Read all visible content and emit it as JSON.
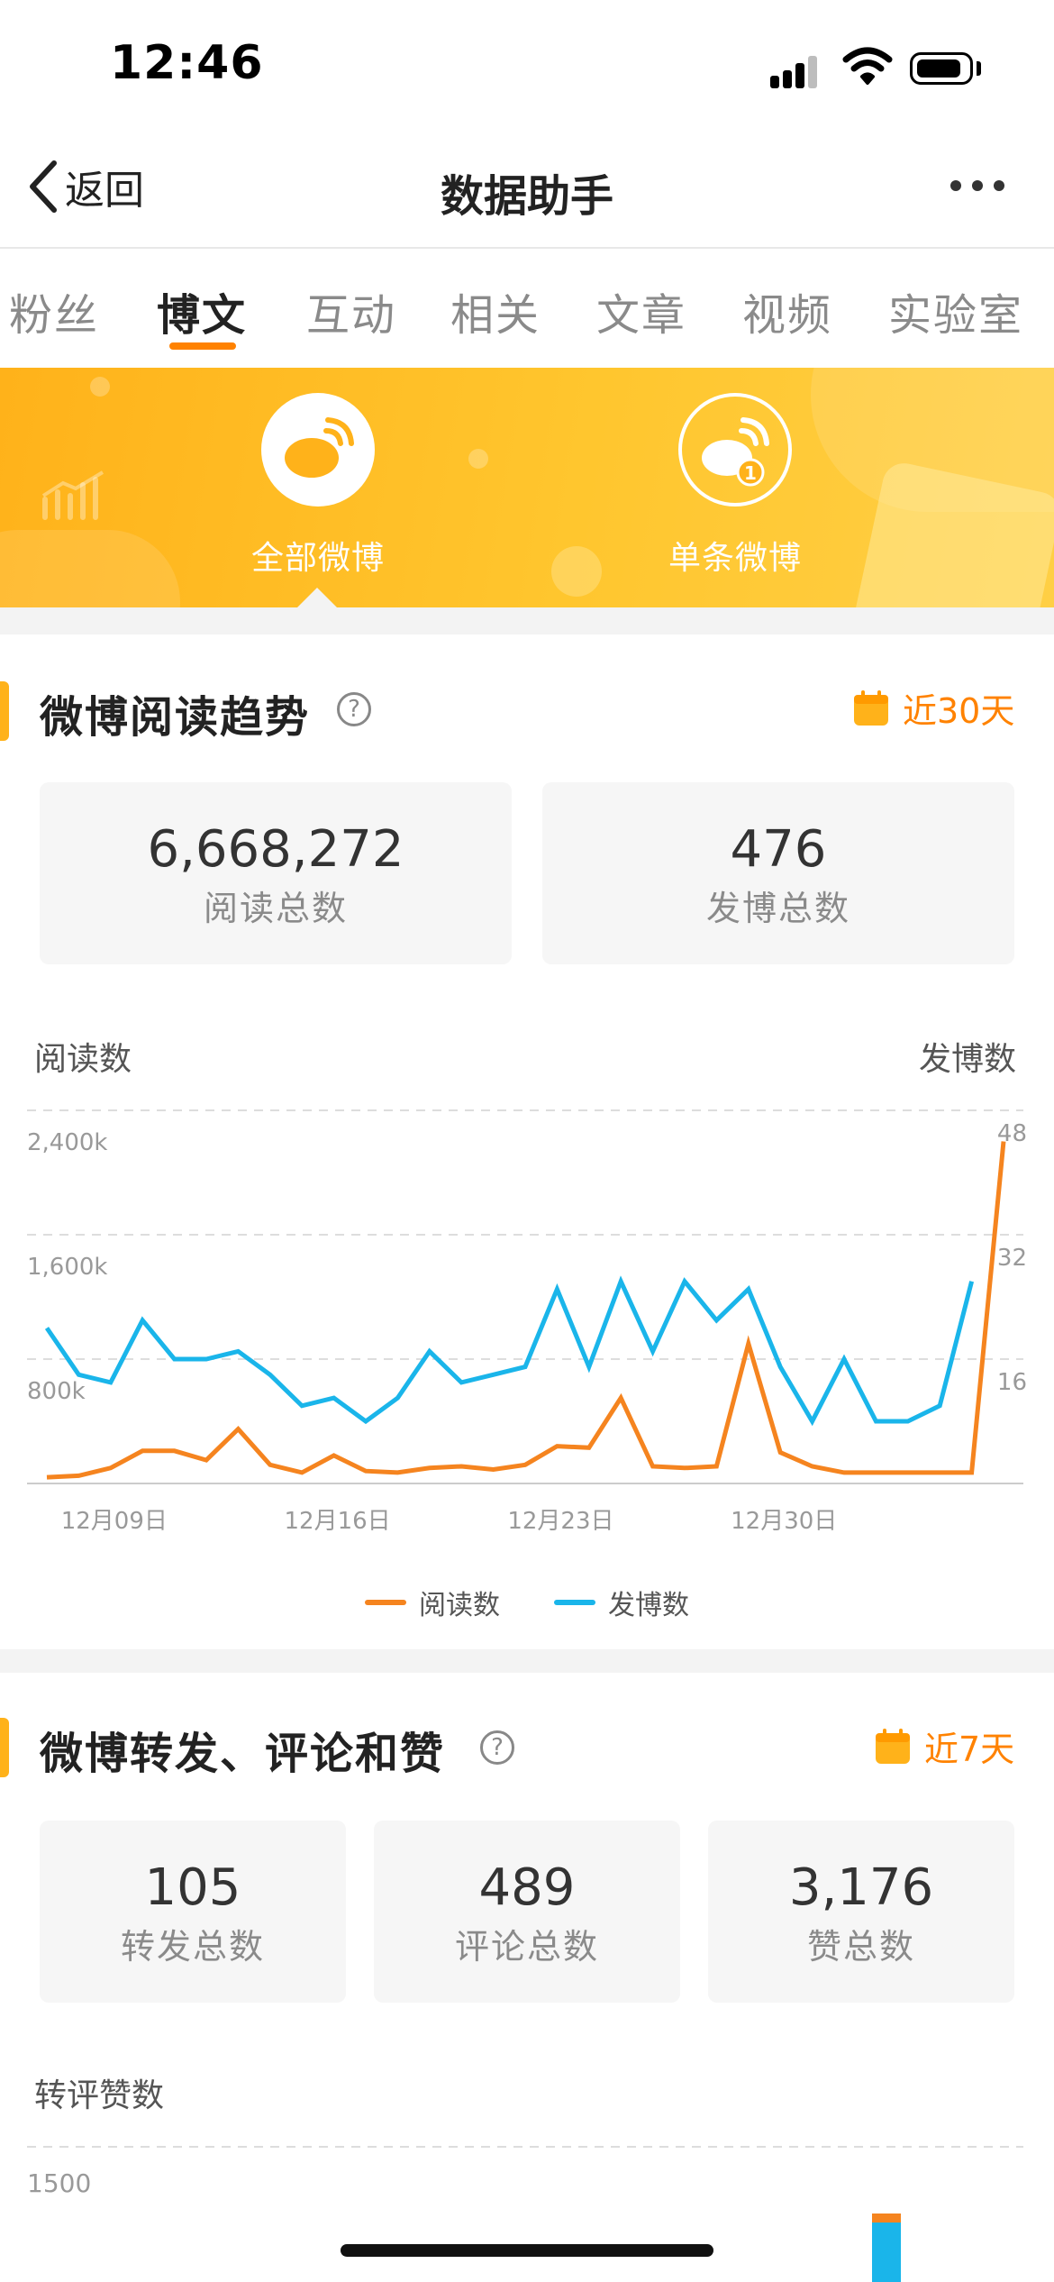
{
  "status_bar": {
    "time": "12:46"
  },
  "nav": {
    "back_label": "返回",
    "title": "数据助手"
  },
  "tabs": [
    {
      "label": "粉丝",
      "active": false
    },
    {
      "label": "博文",
      "active": true
    },
    {
      "label": "互动",
      "active": false
    },
    {
      "label": "相关",
      "active": false
    },
    {
      "label": "文章",
      "active": false
    },
    {
      "label": "视频",
      "active": false
    },
    {
      "label": "实验室",
      "active": false
    }
  ],
  "banner": {
    "all_posts_label": "全部微博",
    "single_post_label": "单条微博",
    "single_badge": "1"
  },
  "read_trend": {
    "title": "微博阅读趋势",
    "help": "?",
    "range_label": "近30天",
    "stats": [
      {
        "value": "6,668,272",
        "label": "阅读总数"
      },
      {
        "value": "476",
        "label": "发博总数"
      }
    ],
    "left_axis_title": "阅读数",
    "right_axis_title": "发博数"
  },
  "engagement": {
    "title": "微博转发、评论和赞",
    "help": "?",
    "range_label": "近7天",
    "stats": [
      {
        "value": "105",
        "label": "转发总数"
      },
      {
        "value": "489",
        "label": "评论总数"
      },
      {
        "value": "3,176",
        "label": "赞总数"
      }
    ],
    "axis_title": "转评赞数",
    "tick_label": "1500"
  },
  "colors": {
    "accent": "#ff8200",
    "reads_series": "#f5841f",
    "posts_series": "#1ab5ea",
    "banner": "#ffbb22"
  },
  "chart_data": {
    "type": "line",
    "x_ticks": [
      "12月09日",
      "12月16日",
      "12月23日",
      "12月30日"
    ],
    "x_tick_index": [
      2,
      9,
      16,
      23
    ],
    "y_left": {
      "ticks": [
        "800k",
        "1,600k",
        "2,400k"
      ],
      "tick_values": [
        800,
        1600,
        2400
      ],
      "max": 2400,
      "unit": "k"
    },
    "y_right": {
      "ticks": [
        "16",
        "32",
        "48"
      ],
      "tick_values": [
        16,
        32,
        48
      ],
      "max": 48
    },
    "grid": true,
    "legend_position": "bottom",
    "series": [
      {
        "name": "阅读数",
        "axis": "left",
        "values": [
          40,
          50,
          100,
          210,
          210,
          150,
          350,
          120,
          70,
          180,
          80,
          70,
          100,
          110,
          90,
          120,
          240,
          230,
          550,
          110,
          100,
          110,
          900,
          200,
          110,
          70,
          70,
          70,
          70,
          70,
          2200
        ]
      },
      {
        "name": "发博数",
        "axis": "right",
        "values": [
          20,
          14,
          13,
          21,
          16,
          16,
          17,
          14,
          10,
          11,
          8,
          11,
          17,
          13,
          14,
          15,
          25,
          15,
          26,
          17,
          26,
          21,
          25,
          15,
          8,
          16,
          8,
          8,
          10,
          26
        ]
      }
    ]
  }
}
